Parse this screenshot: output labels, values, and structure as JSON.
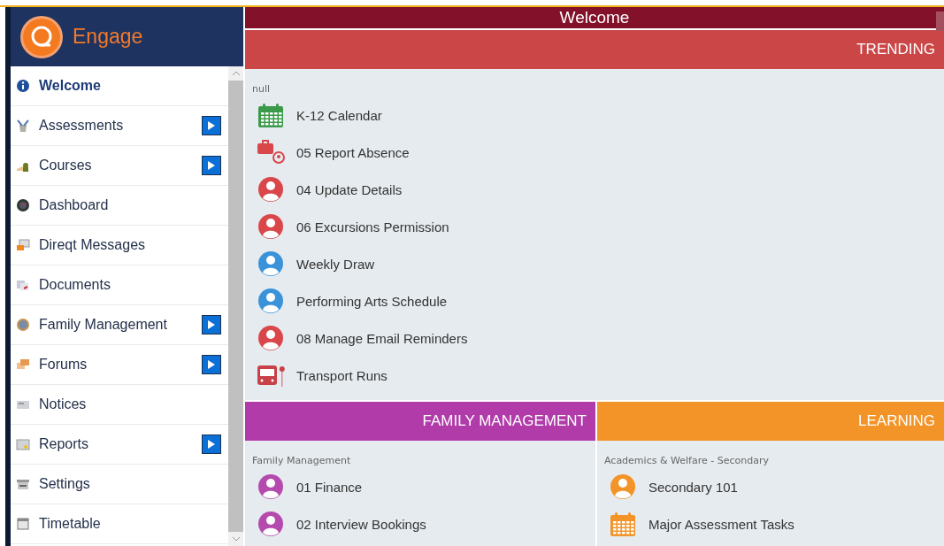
{
  "sidebar": {
    "brand": "Engage",
    "items": [
      {
        "label": "Welcome",
        "selected": true,
        "submenu": false
      },
      {
        "label": "Assessments",
        "selected": false,
        "submenu": true
      },
      {
        "label": "Courses",
        "selected": false,
        "submenu": true
      },
      {
        "label": "Dashboard",
        "selected": false,
        "submenu": false
      },
      {
        "label": "Direqt Messages",
        "selected": false,
        "submenu": false
      },
      {
        "label": "Documents",
        "selected": false,
        "submenu": false
      },
      {
        "label": "Family Management",
        "selected": false,
        "submenu": true
      },
      {
        "label": "Forums",
        "selected": false,
        "submenu": true
      },
      {
        "label": "Notices",
        "selected": false,
        "submenu": false
      },
      {
        "label": "Reports",
        "selected": false,
        "submenu": true
      },
      {
        "label": "Settings",
        "selected": false,
        "submenu": false
      },
      {
        "label": "Timetable",
        "selected": false,
        "submenu": false
      }
    ]
  },
  "page": {
    "title": "Welcome"
  },
  "sections": [
    {
      "title": "TRENDING",
      "color": "#cb4647",
      "group": "null",
      "items": [
        {
          "label": "K-12 Calendar",
          "kind": "calendar",
          "color": "#3a9a4a"
        },
        {
          "label": "05 Report Absence",
          "kind": "absence",
          "color": "#d9474a"
        },
        {
          "label": "04 Update Details",
          "kind": "person",
          "color": "#d9474a"
        },
        {
          "label": "06 Excursions Permission",
          "kind": "person",
          "color": "#d9474a"
        },
        {
          "label": "Weekly Draw",
          "kind": "person",
          "color": "#3a93d9"
        },
        {
          "label": "Performing Arts Schedule",
          "kind": "person",
          "color": "#3a93d9"
        },
        {
          "label": "08 Manage Email Reminders",
          "kind": "person",
          "color": "#d9474a"
        },
        {
          "label": "Transport Runs",
          "kind": "bus",
          "color": "#c84148"
        }
      ]
    },
    {
      "title": "FAMILY MANAGEMENT",
      "color": "#b03ba9",
      "group": "Family Management",
      "items": [
        {
          "label": "01 Finance",
          "kind": "person",
          "color": "#b54aae"
        },
        {
          "label": "02 Interview Bookings",
          "kind": "person",
          "color": "#b54aae"
        }
      ]
    },
    {
      "title": "LEARNING",
      "color": "#f39429",
      "group": "Academics & Welfare - Secondary",
      "items": [
        {
          "label": "Secondary 101",
          "kind": "person",
          "color": "#f39429"
        },
        {
          "label": "Major Assessment Tasks",
          "kind": "calendar",
          "color": "#f39429"
        }
      ]
    }
  ]
}
